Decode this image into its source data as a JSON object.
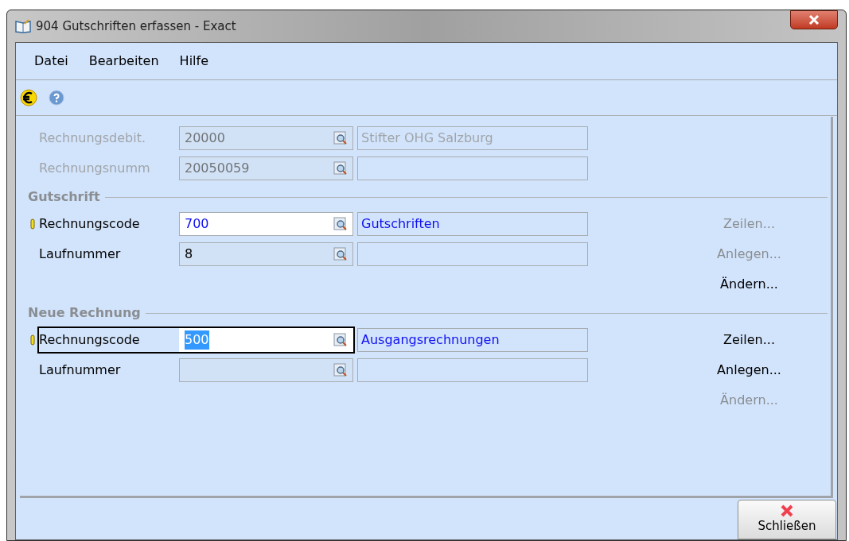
{
  "window": {
    "title": "904 Gutschriften erfassen - Exact"
  },
  "menu": [
    {
      "label": "Datei"
    },
    {
      "label": "Bearbeiten"
    },
    {
      "label": "Hilfe"
    }
  ],
  "sections": [
    {
      "rows": [
        {
          "label": "Rechnungsdebit.",
          "disabled": true,
          "required": false,
          "focused": false,
          "editable": false,
          "value": "20000",
          "value_selected": false,
          "description": "Stifter OHG Salzburg",
          "description_link": false
        },
        {
          "label": "Rechnungsnumm",
          "disabled": true,
          "required": false,
          "focused": false,
          "editable": false,
          "value": "20050059",
          "value_selected": false
        }
      ]
    },
    {
      "title": "Gutschrift",
      "rows": [
        {
          "label": "Rechnungscode",
          "disabled": false,
          "required": true,
          "focused": false,
          "editable": true,
          "value": "700",
          "value_selected": false,
          "description": "Gutschriften",
          "description_link": true
        },
        {
          "label": "Laufnummer",
          "disabled": false,
          "required": false,
          "focused": false,
          "editable": false,
          "value": "8",
          "value_selected": false
        }
      ],
      "actions": [
        {
          "label": "Zeilen...",
          "disabled": true
        },
        {
          "label": "Anlegen...",
          "disabled": true
        },
        {
          "label": "Ändern...",
          "disabled": false
        }
      ]
    },
    {
      "title": "Neue Rechnung",
      "rows": [
        {
          "label": "Rechnungscode",
          "disabled": false,
          "required": true,
          "focused": true,
          "editable": true,
          "value": "500",
          "value_selected": true,
          "description": "Ausgangsrechnungen",
          "description_link": true
        },
        {
          "label": "Laufnummer",
          "disabled": false,
          "required": false,
          "focused": false,
          "editable": false
        }
      ],
      "actions": [
        {
          "label": "Zeilen...",
          "disabled": false
        },
        {
          "label": "Anlegen...",
          "disabled": false
        },
        {
          "label": "Ändern...",
          "disabled": true
        }
      ]
    }
  ],
  "close_button": {
    "label": "Schließen"
  }
}
